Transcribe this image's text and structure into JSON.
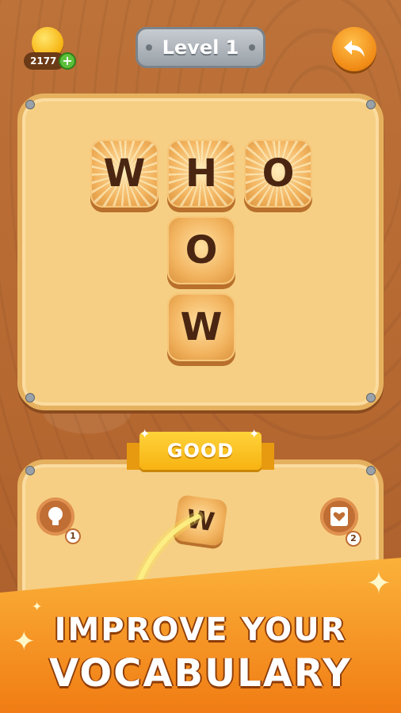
{
  "top_bar": {
    "coin_count": "2177",
    "add_label": "+",
    "level_label": "Level 1"
  },
  "board": {
    "tiles": [
      {
        "letter": "W",
        "style": "lit"
      },
      {
        "letter": "H",
        "style": "lit"
      },
      {
        "letter": "O",
        "style": "lit"
      },
      {
        "letter": "O",
        "style": "plain"
      },
      {
        "letter": "W",
        "style": "plain"
      }
    ]
  },
  "ribbon": {
    "text": "GOOD"
  },
  "input_area": {
    "hint_count": "1",
    "shuffle_count": "2",
    "selected_letter": "W"
  },
  "promo": {
    "line1": "IMPROVE YOUR",
    "line2": "VOCABULARY"
  },
  "colors": {
    "wood": "#b86a34",
    "board": "#f6cf84",
    "tile_text": "#4a2612",
    "banner": "#f08a1d",
    "ribbon": "#ffd33a"
  }
}
